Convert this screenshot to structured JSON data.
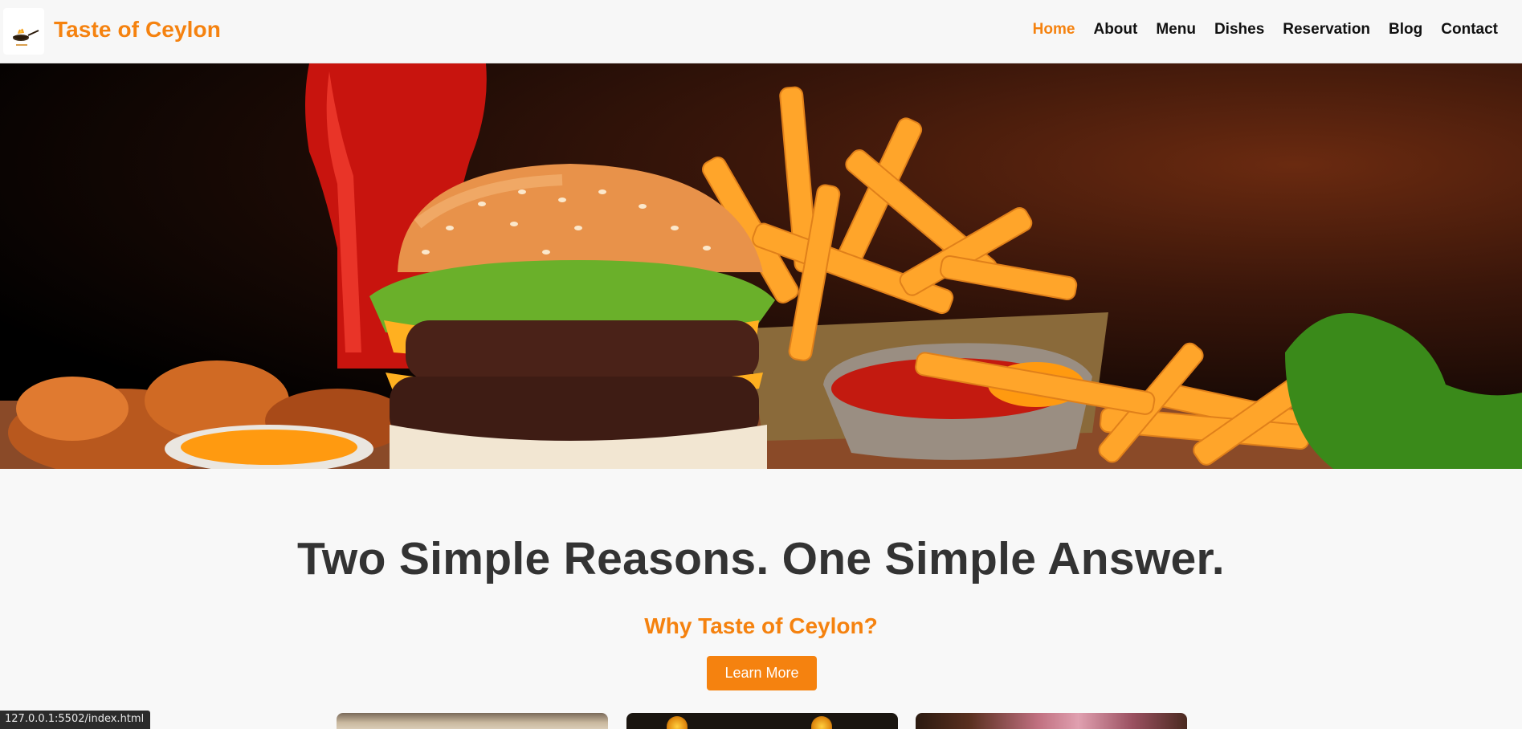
{
  "header": {
    "brand": "Taste of Ceylon",
    "logo_icon": "chef-wok-icon",
    "nav": [
      {
        "label": "Home",
        "active": true
      },
      {
        "label": "About",
        "active": false
      },
      {
        "label": "Menu",
        "active": false
      },
      {
        "label": "Dishes",
        "active": false
      },
      {
        "label": "Reservation",
        "active": false
      },
      {
        "label": "Blog",
        "active": false
      },
      {
        "label": "Contact",
        "active": false
      }
    ]
  },
  "hero": {
    "image": "burger-fries-ketchup-hero-image"
  },
  "main": {
    "headline": "Two Simple Reasons. One Simple Answer.",
    "subheadline": "Why Taste of Ceylon?",
    "cta_label": "Learn More"
  },
  "cards": [
    {
      "image": "restaurant-interior-image"
    },
    {
      "image": "lanterns-night-image"
    },
    {
      "image": "flower-garden-image"
    }
  ],
  "status_bar": {
    "url": "127.0.0.1:5502/index.html"
  },
  "colors": {
    "accent": "#f5820f",
    "headline": "#333333",
    "header_bg": "#f7f7f7",
    "page_bg": "#f8f8f8"
  }
}
